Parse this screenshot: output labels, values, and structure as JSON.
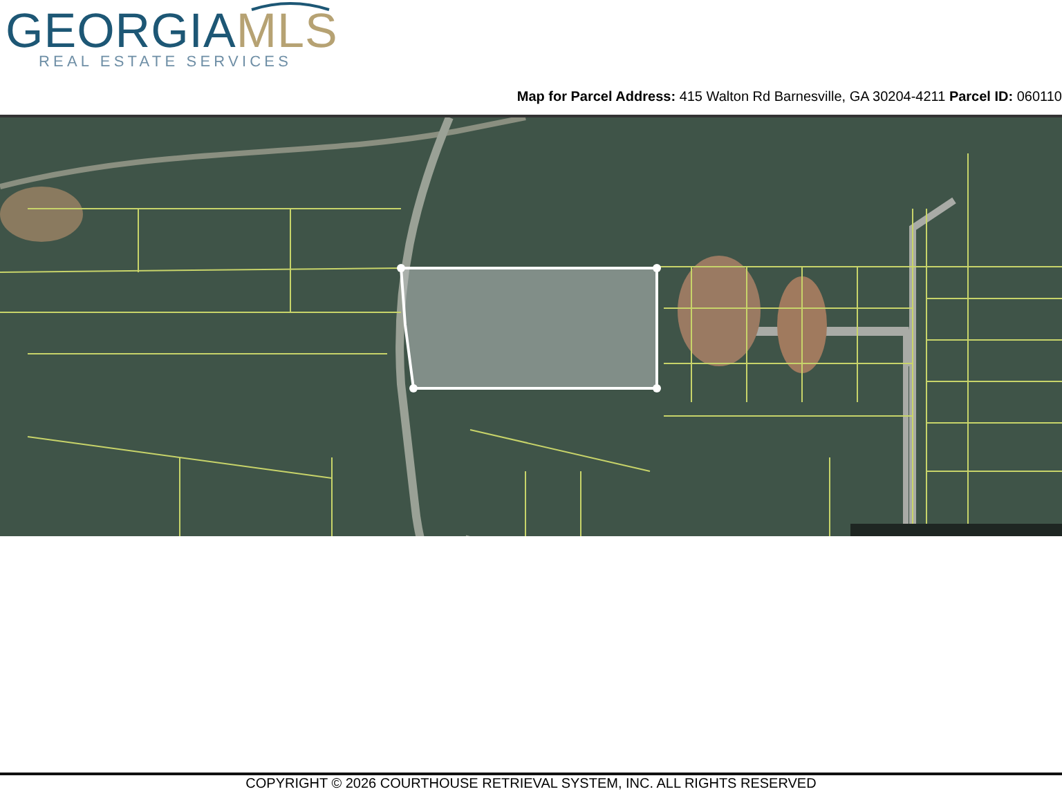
{
  "logo": {
    "primary": "GEORGIA",
    "secondary": "MLS",
    "tagline": "REAL ESTATE SERVICES"
  },
  "header": {
    "address_label": "Map for Parcel Address:",
    "address": "415 Walton Rd Barnesville, GA 30204-4211",
    "parcel_label": "Parcel ID:",
    "parcel_id": "060110"
  },
  "footer": {
    "copyright": "COPYRIGHT © 2026 COURTHOUSE RETRIEVAL SYSTEM, INC. ALL RIGHTS RESERVED"
  }
}
